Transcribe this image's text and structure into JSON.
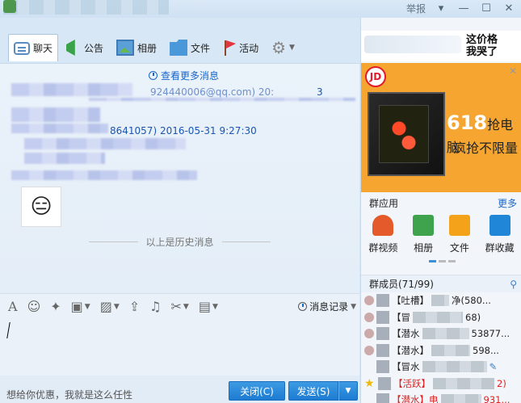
{
  "titlebar": {
    "report": "举报",
    "dropdown_icon": "caret-down-icon",
    "minimize_icon": "minimize-icon",
    "maximize_icon": "maximize-icon",
    "close_icon": "close-icon"
  },
  "tabs": [
    {
      "label": "聊天",
      "icon": "chat-bubble-icon",
      "active": true
    },
    {
      "label": "公告",
      "icon": "notice-flag-icon",
      "active": false
    },
    {
      "label": "相册",
      "icon": "album-icon",
      "active": false
    },
    {
      "label": "文件",
      "icon": "folder-icon",
      "active": false
    },
    {
      "label": "活动",
      "icon": "activity-flag-icon",
      "active": false
    }
  ],
  "chat": {
    "view_more": "查看更多消息",
    "messages": [
      {
        "meta": "924440006@qq.com)  20:",
        "suffix": "3"
      },
      {
        "meta": "8641057)  2016-05-31  9:27:30"
      }
    ],
    "history_divider": "以上是历史消息"
  },
  "input": {
    "message_record": "消息记录"
  },
  "bottom": {
    "hint": "想给你优惠，我就是这么任性",
    "close_label": "关闭(C)",
    "send_label": "发送(S)"
  },
  "right": {
    "ad_top_text_1": "这价格",
    "ad_top_text_2": "我哭了",
    "ad_brand": "JD",
    "ad_line1_num": "618",
    "ad_line1_text": "抢电脑",
    "ad_line2": "疯抢不限量",
    "apps_title": "群应用",
    "apps_more": "更多",
    "apps": [
      {
        "label": "群视频",
        "color": "#e55a2b"
      },
      {
        "label": "相册",
        "color": "#3ea34c"
      },
      {
        "label": "文件",
        "color": "#f3a21a"
      },
      {
        "label": "群收藏",
        "color": "#1f86d8"
      }
    ],
    "members_title": "群成员(71/99)",
    "members": [
      {
        "name": "【吐槽】",
        "tail": "净(580...",
        "red": false
      },
      {
        "name": "【冒",
        "tail": "68)",
        "red": false
      },
      {
        "name": "【潜水",
        "tail": "53877...",
        "red": false
      },
      {
        "name": "【潜水】",
        "tail": "598...",
        "red": false
      },
      {
        "name": "【冒水",
        "tail": "",
        "red": false
      },
      {
        "name": "【活跃】",
        "tail": "2)",
        "red": true
      },
      {
        "name": "【潜水】电",
        "tail": "931...",
        "red": true
      }
    ]
  }
}
